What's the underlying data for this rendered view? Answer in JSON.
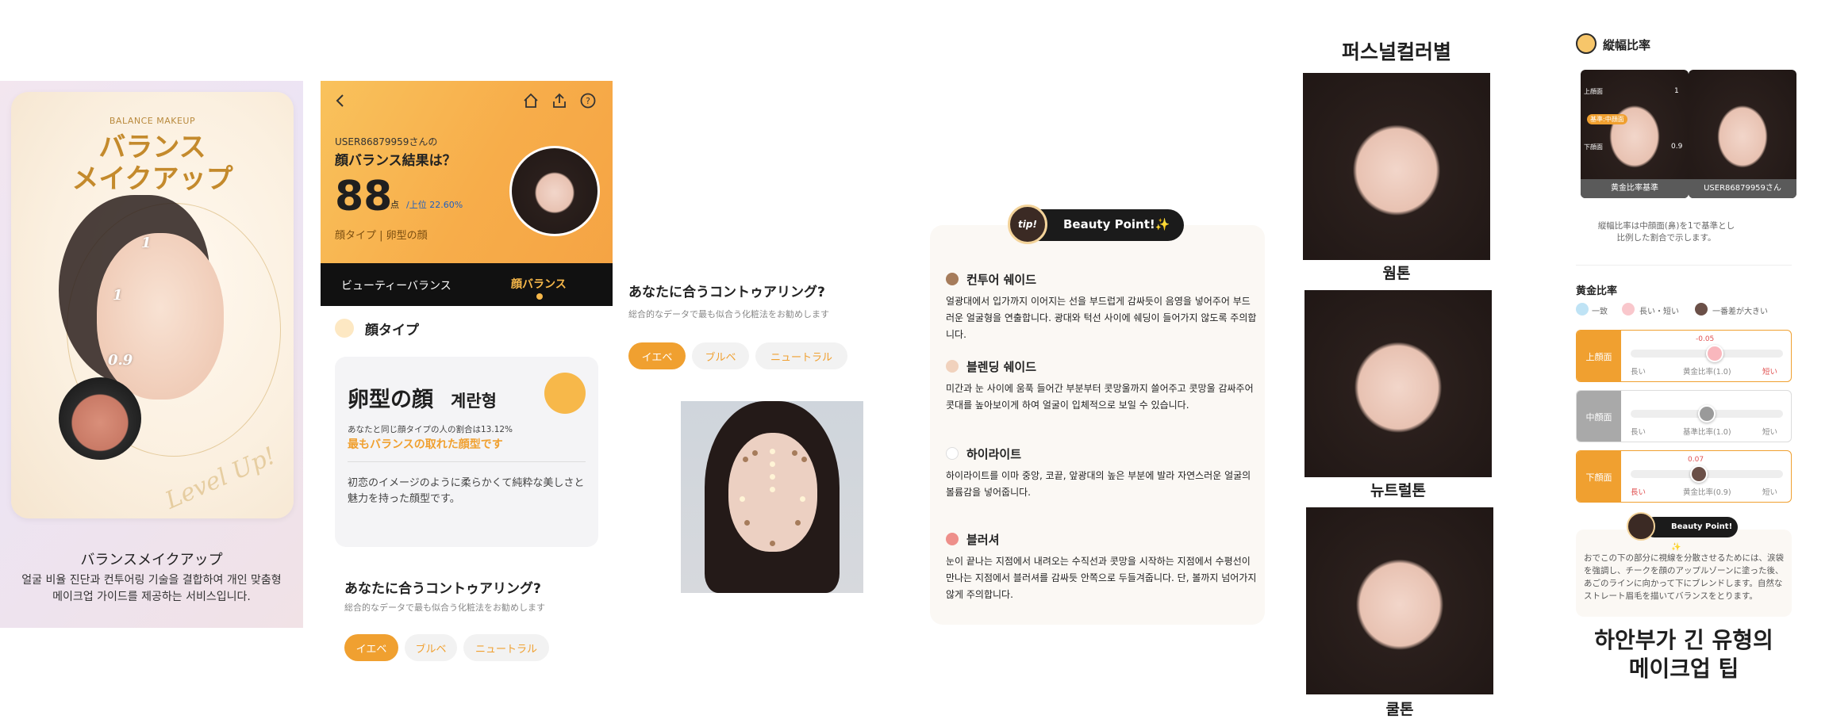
{
  "hero": {
    "kicker": "BALANCE MAKEUP",
    "title_line1": "バランス",
    "title_line2": "メイクアップ",
    "num1": "1",
    "num2": "1",
    "num3": "0.9",
    "script": "Level Up!",
    "name": "バランスメイクアップ",
    "desc": "얼굴 비율 진단과 컨투어링 기술을 결합하여 개인 맞춤형 메이크업 가이드를 제공하는 서비스입니다."
  },
  "result": {
    "back_icon": "chevron-left-icon",
    "home_icon": "home-icon",
    "share_icon": "share-icon",
    "help_icon": "help-icon",
    "user": "USER86879959さんの",
    "question": "顔バランス結果は？",
    "score": "88",
    "score_unit": "点",
    "rank": "/上位 22.60%",
    "type_line": "顔タイプ | 卵型の顔",
    "tabs": [
      {
        "label": "ビューティーバランス",
        "active": false
      },
      {
        "label": "顔バランス",
        "active": true
      }
    ],
    "section_title": "顔タイプ",
    "face_type_ja": "卵型の顔",
    "face_type_kr": "계란형",
    "ratio_text": "あなたと同じ顔タイプの人の割合は13.12%",
    "best": "最もバランスの取れた顔型です",
    "desc": "初恋のイメージのように柔らかくて純粋な美しさと魅力を持った顔型です。",
    "contour_title": "あなたに合うコントゥアリング?",
    "contour_sub": "総合的なデータで最も似合う化粧法をお勧めします",
    "pills": [
      "イエベ",
      "ブルベ",
      "ニュートラル"
    ]
  },
  "contour": {
    "title": "あなたに合うコントゥアリング?",
    "sub": "総合的なデータで最も似合う化粧法をお勧めします",
    "pills": [
      "イエベ",
      "ブルベ",
      "ニュートラル"
    ]
  },
  "beauty_point": {
    "badge_icon_text": "tip!",
    "badge": "Beauty Point!✨",
    "items": [
      {
        "title": "컨투어 쉐이드",
        "color": "#a67c5b",
        "body": "얼광대에서 입가까지 이어지는 선을 부드럽게 감싸듯이 음영을 넣어주어 부드러운 얼굴형을 연출합니다. 광대와 턱선 사이에 쉐딩이 들어가지 않도록 주의합니다."
      },
      {
        "title": "블렌딩 쉐이드",
        "color": "#f1d2bd",
        "body": "미간과 눈 사이에 움푹 들어간 부분부터 콧망울까지 쓸어주고 콧망울 감싸주어 콧대를 높아보이게 하여 얼굴이 입체적으로 보일 수 있습니다."
      },
      {
        "title": "하이라이트",
        "color": "#ffffff",
        "body": "하이라이트를 이마 중앙, 코끝, 앞광대의 높은 부분에 발라 자연스러운 얼굴의 볼륨감을 넣어줍니다."
      },
      {
        "title": "블러셔",
        "color": "#ee8f8a",
        "body": "눈이 끝나는 지점에서 내려오는 수직선과 콧망을 시작하는 지점에서 수평선이 만나는 지점에서 블러셔를 감싸듯 안쪽으로 두들겨줍니다. 단, 볼까지 넘어가지 않게 주의합니다."
      }
    ]
  },
  "personal_color": {
    "title": "퍼스널컬러별",
    "labels": [
      "웜톤",
      "뉴트럴톤",
      "쿨톤"
    ]
  },
  "ratio": {
    "title": "縦幅比率",
    "photo_caps": [
      "黄金比率基準",
      "USER86879959さん"
    ],
    "overlay_labels": [
      "上顔面",
      "基準:中顔面",
      "下顔面"
    ],
    "overlay_values": [
      "1",
      "0.9"
    ],
    "note_line1": "縦幅比率は中顔面(鼻)を1で基準とし",
    "note_line2": "比例した割合で示します。",
    "golden_title": "黄金比率",
    "legend": [
      "一致",
      "長い・短い",
      "一番差が大きい"
    ],
    "rows": [
      {
        "label": "上顔面",
        "value": "-0.05",
        "left": "長い",
        "mid": "黄金比率(1.0)",
        "right": "短い",
        "color": "#f0a030",
        "level": 0.55
      },
      {
        "label": "中顔面",
        "value": "",
        "left": "長い",
        "mid": "基準比率(1.0)",
        "right": "短い",
        "color": "#a9a9a9",
        "level": 0.5
      },
      {
        "label": "下顔面",
        "value": "0.07",
        "left": "長い",
        "mid": "黄金比率(0.9)",
        "right": "短い",
        "color": "#f0a030",
        "level": 0.45
      }
    ],
    "tip_badge": "Beauty Point!✨",
    "tip_text": "おでこの下の部分に視線を分散させるためには、涙袋を強調し、チークを顔のアップルゾーンに塗った後、あごのラインに向かって下にブレンドします。自然なストレート眉毛を描いてバランスをとります。",
    "big_title_line1": "하안부가 긴 유형의",
    "big_title_line2": "메이크업 팁"
  }
}
